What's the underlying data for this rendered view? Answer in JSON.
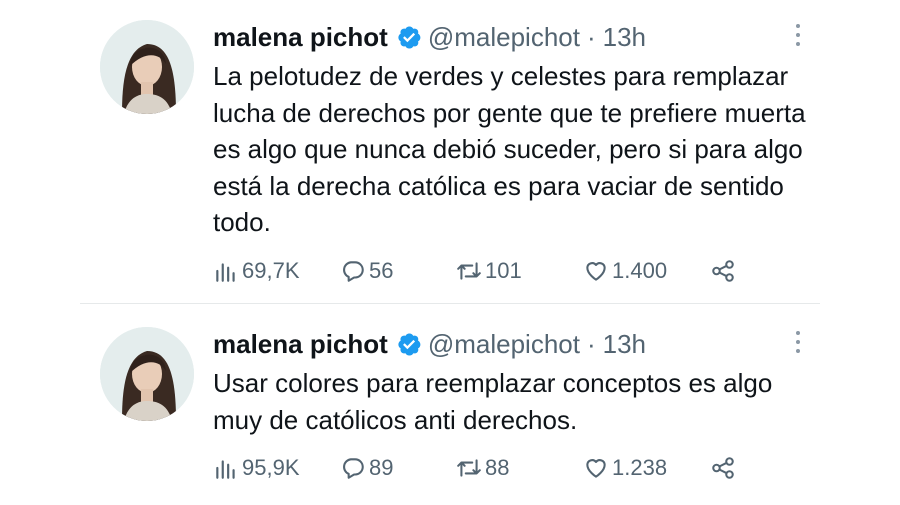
{
  "tweets": [
    {
      "author": {
        "name": "malena pichot",
        "handle": "@malepichot",
        "separator": "·",
        "time": "13h"
      },
      "text": "La pelotudez de verdes y celestes para remplazar lucha de derechos por gente que te prefiere muerta es algo que nunca debió suceder, pero si para algo está la derecha católica es para vaciar de sentido todo.",
      "stats": {
        "views": "69,7K",
        "replies": "56",
        "retweets": "101",
        "likes": "1.400"
      }
    },
    {
      "author": {
        "name": "malena pichot",
        "handle": "@malepichot",
        "separator": "·",
        "time": "13h"
      },
      "text": "Usar colores para reemplazar conceptos es algo muy de católicos anti derechos.",
      "stats": {
        "views": "95,9K",
        "replies": "89",
        "retweets": "88",
        "likes": "1.238"
      }
    }
  ],
  "icons": {
    "verified": "verified-badge-icon",
    "views": "bar-chart-icon",
    "reply": "speech-bubble-icon",
    "retweet": "retweet-arrows-icon",
    "like": "heart-icon",
    "share": "share-nodes-icon",
    "more": "vertical-ellipsis-icon"
  },
  "colors": {
    "verified_blue": "#1d9bf0",
    "text_primary": "#0f1419",
    "text_secondary": "#536471"
  }
}
